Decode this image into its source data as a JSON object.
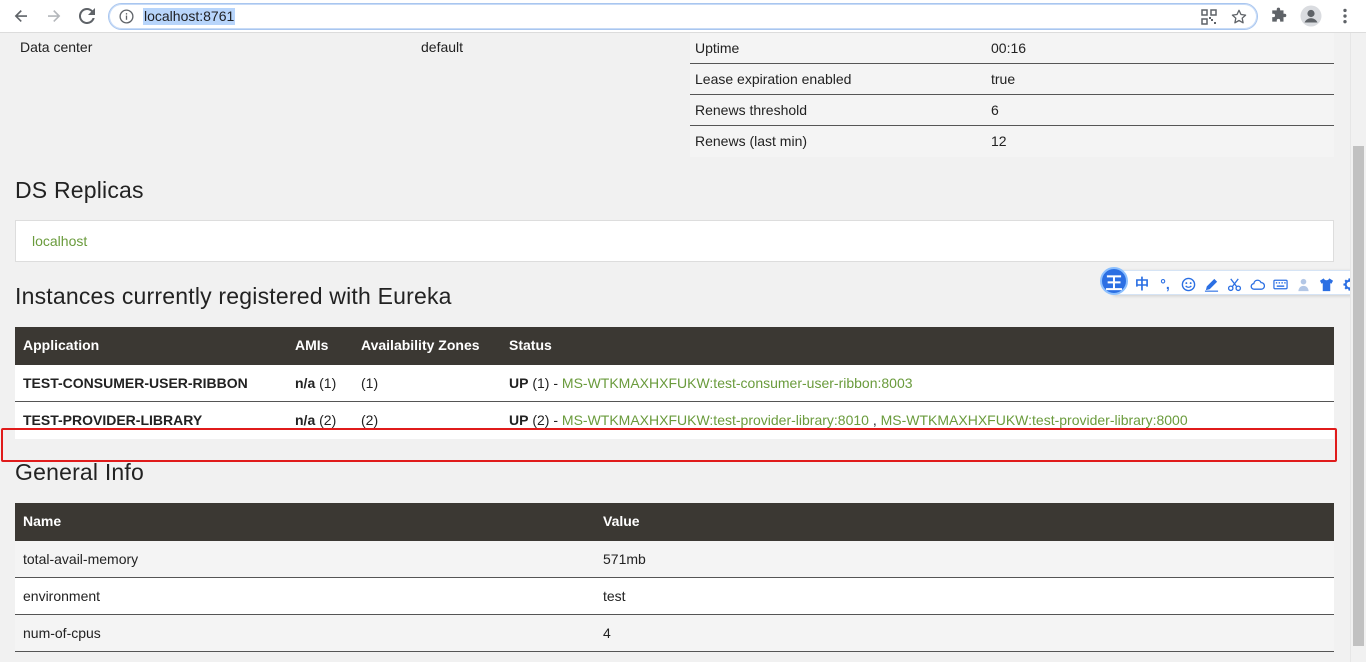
{
  "browser": {
    "url": "localhost:8761"
  },
  "system_status": {
    "left": [
      {
        "key": "Data center",
        "value": "default"
      }
    ],
    "right": [
      {
        "key": "Uptime",
        "value": "00:16"
      },
      {
        "key": "Lease expiration enabled",
        "value": "true"
      },
      {
        "key": "Renews threshold",
        "value": "6"
      },
      {
        "key": "Renews (last min)",
        "value": "12"
      }
    ]
  },
  "replicas": {
    "title": "DS Replicas",
    "items": [
      "localhost"
    ]
  },
  "instances": {
    "title": "Instances currently registered with Eureka",
    "columns": [
      "Application",
      "AMIs",
      "Availability Zones",
      "Status"
    ],
    "rows": [
      {
        "application": "TEST-CONSUMER-USER-RIBBON",
        "amis_label": "n/a",
        "amis_count": "(1)",
        "zones": "(1)",
        "status": "UP",
        "status_count": "(1) -",
        "links": [
          "MS-WTKMAXHXFUKW:test-consumer-user-ribbon:8003"
        ]
      },
      {
        "application": "TEST-PROVIDER-LIBRARY",
        "amis_label": "n/a",
        "amis_count": "(2)",
        "zones": "(2)",
        "status": "UP",
        "status_count": "(2) -",
        "links": [
          "MS-WTKMAXHXFUKW:test-provider-library:8010",
          "MS-WTKMAXHXFUKW:test-provider-library:8000"
        ],
        "link_separator": ","
      }
    ]
  },
  "general_info": {
    "title": "General Info",
    "columns": [
      "Name",
      "Value"
    ],
    "rows": [
      {
        "name": "total-avail-memory",
        "value": "571mb"
      },
      {
        "name": "environment",
        "value": "test"
      },
      {
        "name": "num-of-cpus",
        "value": "4"
      }
    ]
  },
  "ime_toolbar": {
    "logo": "王",
    "mode": "中",
    "punct": "°,"
  },
  "colors": {
    "accent_green": "#6a9b3c",
    "table_header": "#3b3833",
    "highlight_red": "#e01b1b"
  }
}
